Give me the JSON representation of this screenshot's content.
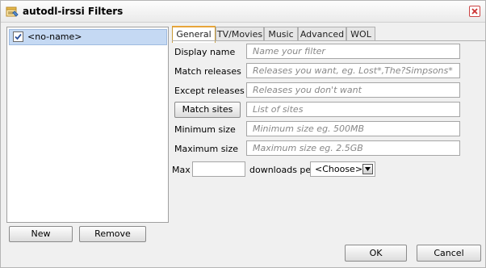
{
  "window": {
    "title": "autodl-irssi Filters"
  },
  "filters": [
    {
      "label": "<no-name>",
      "checked": true
    }
  ],
  "list_buttons": {
    "new": "New",
    "remove": "Remove"
  },
  "tabs": [
    {
      "label": "General",
      "active": true
    },
    {
      "label": "TV/Movies",
      "active": false
    },
    {
      "label": "Music",
      "active": false
    },
    {
      "label": "Advanced",
      "active": false
    },
    {
      "label": "WOL",
      "active": false
    }
  ],
  "general": {
    "display_name": {
      "label": "Display name",
      "placeholder": "Name your filter"
    },
    "match_releases": {
      "label": "Match releases",
      "placeholder": "Releases you want, eg. Lost*,The?Simpsons*"
    },
    "except_releases": {
      "label": "Except releases",
      "placeholder": "Releases you don't want"
    },
    "match_sites": {
      "button": "Match sites",
      "placeholder": "List of sites"
    },
    "minimum_size": {
      "label": "Minimum size",
      "placeholder": "Minimum size eg. 500MB"
    },
    "maximum_size": {
      "label": "Maximum size",
      "placeholder": "Maximum size eg. 2.5GB"
    },
    "max_downloads": {
      "prefix": "Max",
      "value": "",
      "middle": "downloads per",
      "per_value": "<Choose>"
    }
  },
  "footer": {
    "ok": "OK",
    "cancel": "Cancel"
  }
}
